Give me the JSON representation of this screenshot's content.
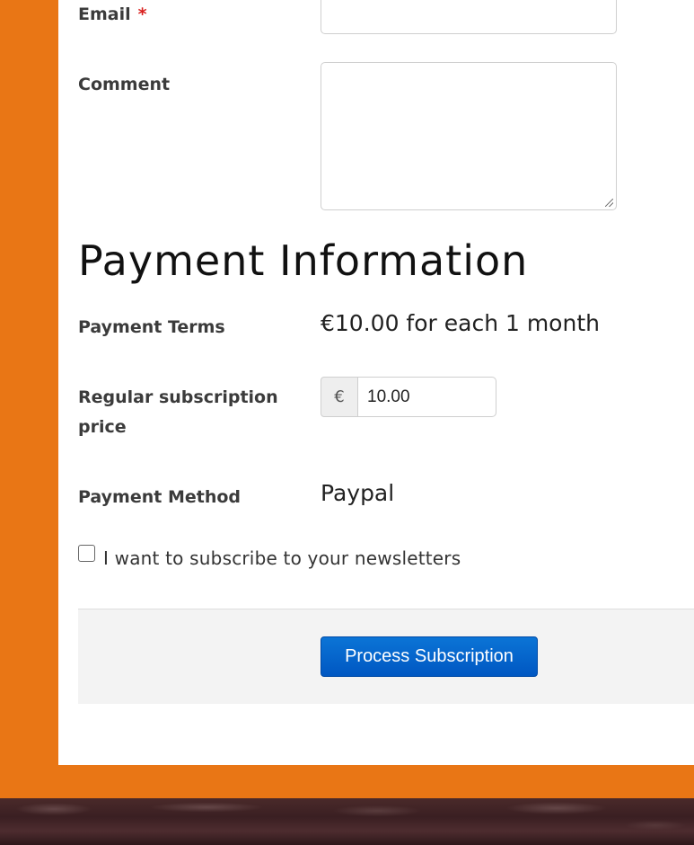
{
  "form": {
    "email_label": "Email",
    "required_marker": "*",
    "email_value": "",
    "comment_label": "Comment",
    "comment_value": ""
  },
  "payment": {
    "heading": "Payment Information",
    "terms_label": "Payment Terms",
    "terms_value": "€10.00 for each 1 month",
    "price_label": "Regular subscription price",
    "currency_symbol": "€",
    "price_value": "10.00",
    "method_label": "Payment Method",
    "method_value": "Paypal"
  },
  "newsletter": {
    "label": "I want to subscribe to your newsletters",
    "checked": false
  },
  "actions": {
    "submit_label": "Process Subscription"
  },
  "colors": {
    "background_orange": "#e97615",
    "button_blue": "#0b74d6",
    "required_red": "#d9201e"
  }
}
